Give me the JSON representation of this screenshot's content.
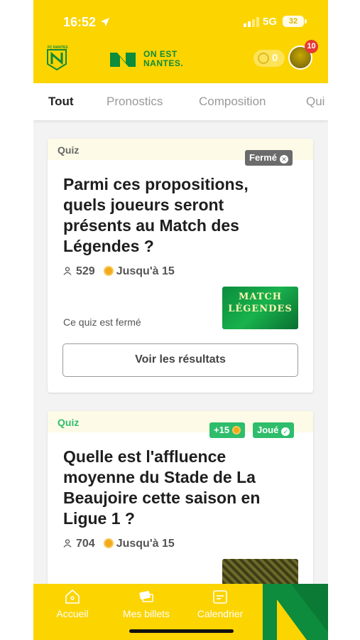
{
  "status": {
    "time": "16:52",
    "network": "5G",
    "battery": "32"
  },
  "header": {
    "club_logo_text": "FC NANTES",
    "brand_line1": "ON EST",
    "brand_line2": "NANTES.",
    "coins": "0",
    "notifications": "10"
  },
  "tabs": [
    {
      "label": "Tout",
      "active": true
    },
    {
      "label": "Pronostics",
      "active": false
    },
    {
      "label": "Composition",
      "active": false
    },
    {
      "label": "Qui",
      "active": false
    }
  ],
  "cards": [
    {
      "type": "Quiz",
      "badge": "Fermé",
      "title": "Parmi ces propositions, quels joueurs seront présents au Match des Légendes ?",
      "participants": "529",
      "reward": "Jusqu'à 15",
      "closed_text": "Ce quiz est fermé",
      "image_text_1": "MATCH",
      "image_text_2": "LÉGENDES",
      "button": "Voir les résultats"
    },
    {
      "type": "Quiz",
      "bonus": "+15",
      "badge": "Joué",
      "title": "Quelle est l'affluence moyenne du Stade de La Beaujoire cette saison en Ligue 1 ?",
      "participants": "704",
      "reward": "Jusqu'à 15"
    }
  ],
  "bottom_nav": [
    {
      "label": "Accueil",
      "icon": "home-icon"
    },
    {
      "label": "Mes billets",
      "icon": "tickets-icon"
    },
    {
      "label": "Calendrier",
      "icon": "calendar-icon"
    }
  ],
  "colors": {
    "primary": "#fcd400",
    "green": "#2ebd6b",
    "brand_green": "#0c8c3c"
  }
}
